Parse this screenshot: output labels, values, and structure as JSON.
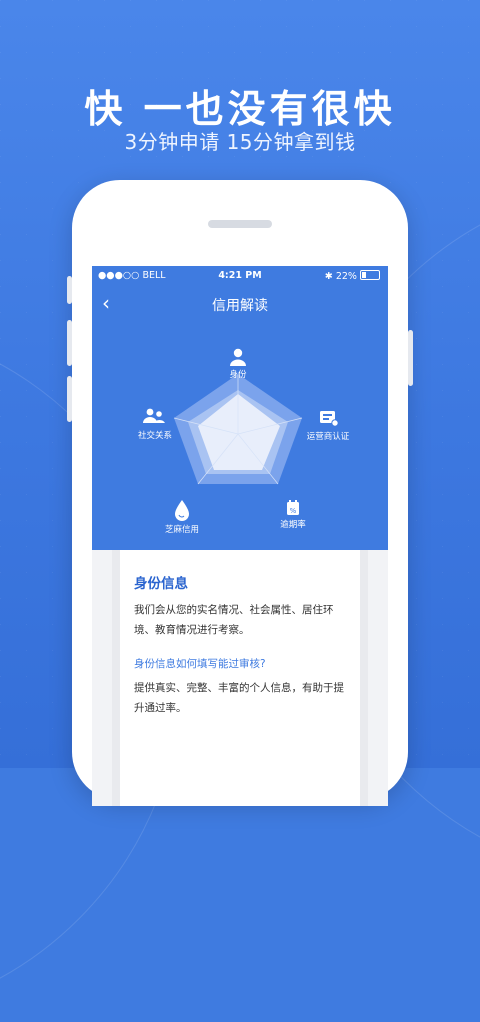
{
  "promo": {
    "headline": "快 一也没有很快",
    "subline": "3分钟申请 15分钟拿到钱"
  },
  "status_bar": {
    "carrier": "●●●○○ BELL",
    "time": "4:21 PM",
    "battery": "22%"
  },
  "navbar": {
    "back_icon": "chevron-left-icon",
    "title": "信用解读"
  },
  "radar": {
    "axes": [
      {
        "label": "身份",
        "icon": "person-icon"
      },
      {
        "label": "运营商认证",
        "icon": "carrier-card-icon"
      },
      {
        "label": "逾期率",
        "icon": "overdue-calendar-icon"
      },
      {
        "label": "芝麻信用",
        "icon": "sesame-drop-icon"
      },
      {
        "label": "社交关系",
        "icon": "social-people-icon"
      }
    ],
    "colors": {
      "bg": "#3f7be0",
      "outer": "#7ea5ec",
      "mid": "#a9c3f2",
      "inner": "#e8eefb"
    }
  },
  "card": {
    "title": "身份信息",
    "body": "我们会从您的实名情况、社会属性、居住环境、教育情况进行考察。",
    "question": "身份信息如何填写能过审核?",
    "answer": "提供真实、完整、丰富的个人信息，有助于提升通过率。"
  }
}
